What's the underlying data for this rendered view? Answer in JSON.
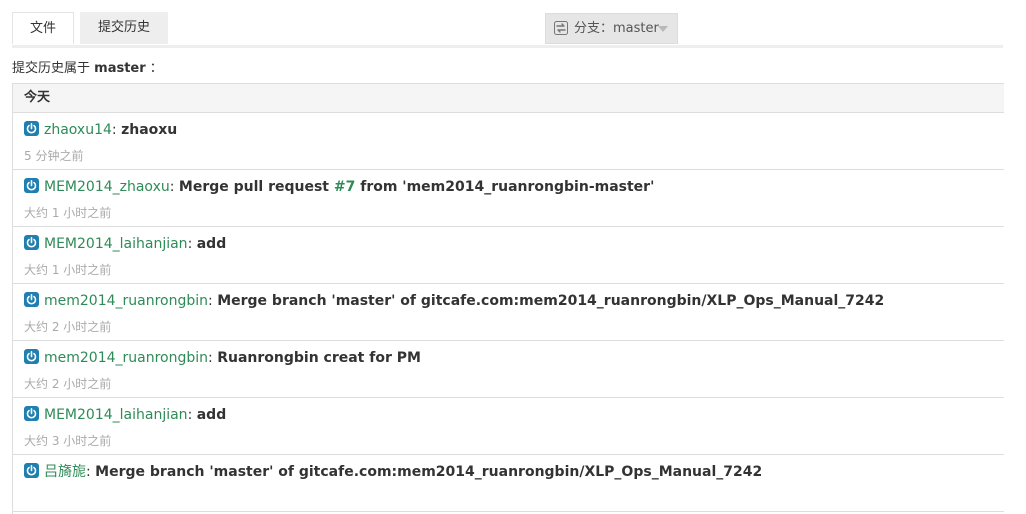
{
  "tabs": {
    "files": "文件",
    "history": "提交历史"
  },
  "branch": {
    "label": "分支：master"
  },
  "history": {
    "prefix": "提交历史属于",
    "branch": "master",
    "suffix": "："
  },
  "groups": [
    {
      "day": "今天",
      "commits": [
        {
          "author": "zhaoxu14",
          "message": "zhaoxu",
          "time": "5 分钟之前"
        },
        {
          "author": "MEM2014_zhaoxu",
          "message_pre": "Merge pull request ",
          "pr": "#7",
          "message_post": " from 'mem2014_ruanrongbin-master'",
          "time": "大约 1 小时之前"
        },
        {
          "author": "MEM2014_laihanjian",
          "message": "add",
          "time": "大约 1 小时之前"
        },
        {
          "author": "mem2014_ruanrongbin",
          "message": "Merge branch 'master' of gitcafe.com:mem2014_ruanrongbin/XLP_Ops_Manual_7242",
          "time": "大约 2 小时之前"
        },
        {
          "author": "mem2014_ruanrongbin",
          "message": "Ruanrongbin creat for PM",
          "time": "大约 2 小时之前"
        },
        {
          "author": "MEM2014_laihanjian",
          "message": "add",
          "time": "大约 3 小时之前"
        },
        {
          "author": "吕旖旎",
          "message": "Merge branch 'master' of gitcafe.com:mem2014_ruanrongbin/XLP_Ops_Manual_7242",
          "time": ""
        }
      ]
    }
  ],
  "colors": {
    "author": "#2e8b57",
    "icon": "#1f7fb0",
    "muted": "#aaaaaa"
  },
  "icons": {
    "commit": "power-icon",
    "branch": "branch-switch-icon",
    "caret": "caret-down-icon"
  }
}
